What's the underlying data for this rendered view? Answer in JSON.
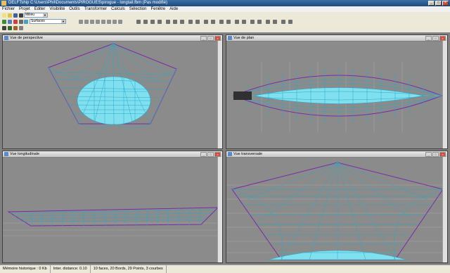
{
  "window": {
    "title": "DELFTship C:\\Users\\Phil\\Documents\\PIROGUES\\pirogue - longtail.fbm (Pas modifié)"
  },
  "menu": [
    "Fichier",
    "Projet",
    "Editer",
    "Visibilité",
    "Outils",
    "Transformer",
    "Calculs",
    "Sélection",
    "Fenêtre",
    "Aide"
  ],
  "toolbar": {
    "combo1": "Milieu",
    "combo2": "Surfaces"
  },
  "views": {
    "perspective": "Vue de perspective",
    "plan": "Vue de plan",
    "longitudinal": "Vue longitudinale",
    "transversal": "Vue transversale"
  },
  "status": {
    "memory": "Mémoire historique : 0 Kb",
    "distance": "Inter. distance: 0.10",
    "summary": "10 faces, 20 Bords, 29 Points, 3 courbes"
  },
  "colors": {
    "mesh": "#2aa8c8",
    "outline": "#7a2aa8",
    "background": "#8b8b8b",
    "surface": "#80e0f0"
  }
}
